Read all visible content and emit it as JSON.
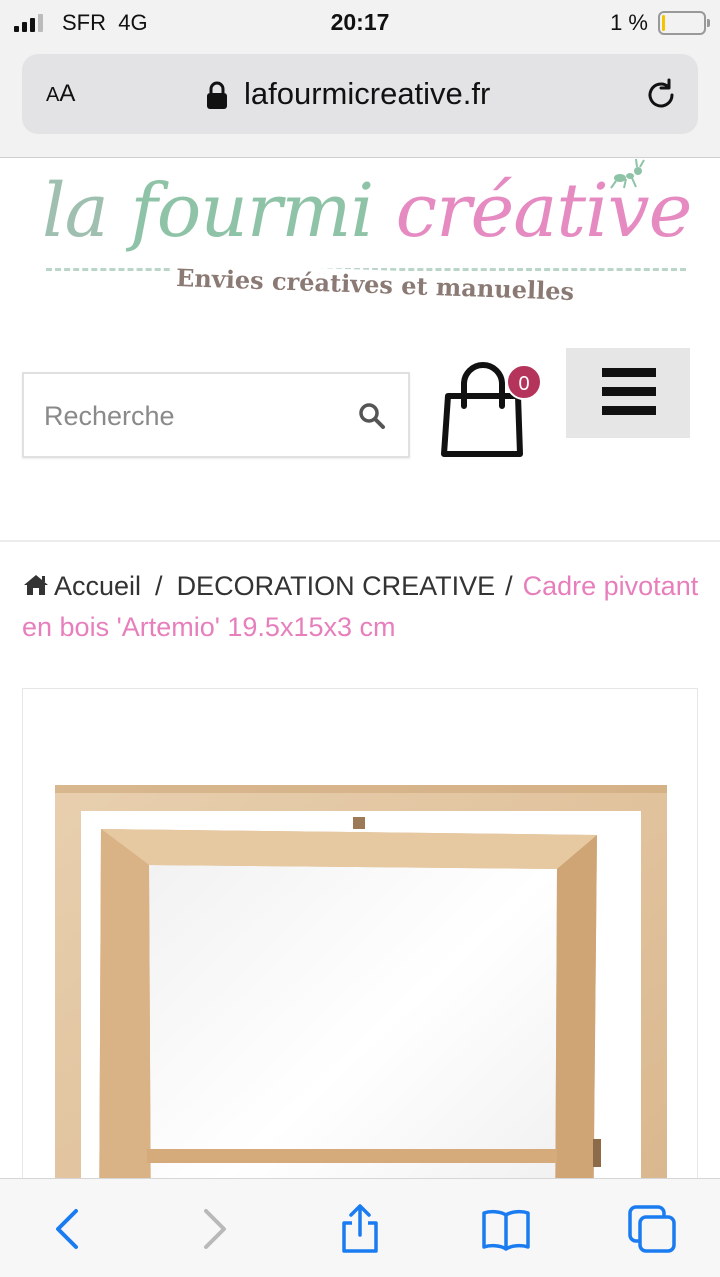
{
  "status_bar": {
    "carrier": "SFR",
    "network": "4G",
    "time": "20:17",
    "battery_percent": "1 %",
    "battery_level": 0.01
  },
  "browser": {
    "text_size_label_small": "A",
    "text_size_label_large": "A",
    "url": "lafourmicreative.fr",
    "icons": [
      "lock-icon",
      "reload-icon"
    ]
  },
  "logo": {
    "word_la": "la",
    "word_fourmi": "fourmi",
    "word_creative": "créative",
    "tagline": "Envies créatives et manuelles"
  },
  "header": {
    "search_placeholder": "Recherche",
    "cart_count": "0"
  },
  "breadcrumb": {
    "home": "Accueil",
    "category": "DECORATION CREATIVE",
    "separator": "/",
    "current": "Cadre pivotant en bois 'Artemio' 19.5x15x3 cm"
  },
  "colors": {
    "accent_pink": "#e77fbd",
    "logo_green": "#8ec3a7",
    "badge": "#b5345c",
    "ios_blue": "#1a7cf0"
  },
  "toolbar": {
    "icons": [
      "back-icon",
      "forward-icon",
      "share-icon",
      "bookmarks-icon",
      "tabs-icon"
    ]
  }
}
